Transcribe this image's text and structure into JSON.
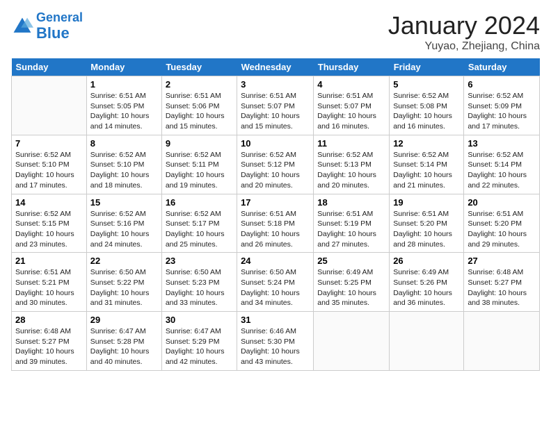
{
  "header": {
    "logo_line1": "General",
    "logo_line2": "Blue",
    "month": "January 2024",
    "location": "Yuyao, Zhejiang, China"
  },
  "weekdays": [
    "Sunday",
    "Monday",
    "Tuesday",
    "Wednesday",
    "Thursday",
    "Friday",
    "Saturday"
  ],
  "weeks": [
    [
      {
        "day": "",
        "info": ""
      },
      {
        "day": "1",
        "info": "Sunrise: 6:51 AM\nSunset: 5:05 PM\nDaylight: 10 hours\nand 14 minutes."
      },
      {
        "day": "2",
        "info": "Sunrise: 6:51 AM\nSunset: 5:06 PM\nDaylight: 10 hours\nand 15 minutes."
      },
      {
        "day": "3",
        "info": "Sunrise: 6:51 AM\nSunset: 5:07 PM\nDaylight: 10 hours\nand 15 minutes."
      },
      {
        "day": "4",
        "info": "Sunrise: 6:51 AM\nSunset: 5:07 PM\nDaylight: 10 hours\nand 16 minutes."
      },
      {
        "day": "5",
        "info": "Sunrise: 6:52 AM\nSunset: 5:08 PM\nDaylight: 10 hours\nand 16 minutes."
      },
      {
        "day": "6",
        "info": "Sunrise: 6:52 AM\nSunset: 5:09 PM\nDaylight: 10 hours\nand 17 minutes."
      }
    ],
    [
      {
        "day": "7",
        "info": "Sunrise: 6:52 AM\nSunset: 5:10 PM\nDaylight: 10 hours\nand 17 minutes."
      },
      {
        "day": "8",
        "info": "Sunrise: 6:52 AM\nSunset: 5:10 PM\nDaylight: 10 hours\nand 18 minutes."
      },
      {
        "day": "9",
        "info": "Sunrise: 6:52 AM\nSunset: 5:11 PM\nDaylight: 10 hours\nand 19 minutes."
      },
      {
        "day": "10",
        "info": "Sunrise: 6:52 AM\nSunset: 5:12 PM\nDaylight: 10 hours\nand 20 minutes."
      },
      {
        "day": "11",
        "info": "Sunrise: 6:52 AM\nSunset: 5:13 PM\nDaylight: 10 hours\nand 20 minutes."
      },
      {
        "day": "12",
        "info": "Sunrise: 6:52 AM\nSunset: 5:14 PM\nDaylight: 10 hours\nand 21 minutes."
      },
      {
        "day": "13",
        "info": "Sunrise: 6:52 AM\nSunset: 5:14 PM\nDaylight: 10 hours\nand 22 minutes."
      }
    ],
    [
      {
        "day": "14",
        "info": "Sunrise: 6:52 AM\nSunset: 5:15 PM\nDaylight: 10 hours\nand 23 minutes."
      },
      {
        "day": "15",
        "info": "Sunrise: 6:52 AM\nSunset: 5:16 PM\nDaylight: 10 hours\nand 24 minutes."
      },
      {
        "day": "16",
        "info": "Sunrise: 6:52 AM\nSunset: 5:17 PM\nDaylight: 10 hours\nand 25 minutes."
      },
      {
        "day": "17",
        "info": "Sunrise: 6:51 AM\nSunset: 5:18 PM\nDaylight: 10 hours\nand 26 minutes."
      },
      {
        "day": "18",
        "info": "Sunrise: 6:51 AM\nSunset: 5:19 PM\nDaylight: 10 hours\nand 27 minutes."
      },
      {
        "day": "19",
        "info": "Sunrise: 6:51 AM\nSunset: 5:20 PM\nDaylight: 10 hours\nand 28 minutes."
      },
      {
        "day": "20",
        "info": "Sunrise: 6:51 AM\nSunset: 5:20 PM\nDaylight: 10 hours\nand 29 minutes."
      }
    ],
    [
      {
        "day": "21",
        "info": "Sunrise: 6:51 AM\nSunset: 5:21 PM\nDaylight: 10 hours\nand 30 minutes."
      },
      {
        "day": "22",
        "info": "Sunrise: 6:50 AM\nSunset: 5:22 PM\nDaylight: 10 hours\nand 31 minutes."
      },
      {
        "day": "23",
        "info": "Sunrise: 6:50 AM\nSunset: 5:23 PM\nDaylight: 10 hours\nand 33 minutes."
      },
      {
        "day": "24",
        "info": "Sunrise: 6:50 AM\nSunset: 5:24 PM\nDaylight: 10 hours\nand 34 minutes."
      },
      {
        "day": "25",
        "info": "Sunrise: 6:49 AM\nSunset: 5:25 PM\nDaylight: 10 hours\nand 35 minutes."
      },
      {
        "day": "26",
        "info": "Sunrise: 6:49 AM\nSunset: 5:26 PM\nDaylight: 10 hours\nand 36 minutes."
      },
      {
        "day": "27",
        "info": "Sunrise: 6:48 AM\nSunset: 5:27 PM\nDaylight: 10 hours\nand 38 minutes."
      }
    ],
    [
      {
        "day": "28",
        "info": "Sunrise: 6:48 AM\nSunset: 5:27 PM\nDaylight: 10 hours\nand 39 minutes."
      },
      {
        "day": "29",
        "info": "Sunrise: 6:47 AM\nSunset: 5:28 PM\nDaylight: 10 hours\nand 40 minutes."
      },
      {
        "day": "30",
        "info": "Sunrise: 6:47 AM\nSunset: 5:29 PM\nDaylight: 10 hours\nand 42 minutes."
      },
      {
        "day": "31",
        "info": "Sunrise: 6:46 AM\nSunset: 5:30 PM\nDaylight: 10 hours\nand 43 minutes."
      },
      {
        "day": "",
        "info": ""
      },
      {
        "day": "",
        "info": ""
      },
      {
        "day": "",
        "info": ""
      }
    ]
  ]
}
